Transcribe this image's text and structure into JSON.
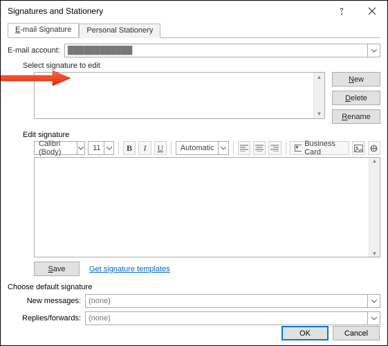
{
  "window": {
    "title": "Signatures and Stationery"
  },
  "tabs": {
    "email": "E-mail Signature",
    "personal": "Personal Stationery"
  },
  "labels": {
    "email_account": "E-mail account:",
    "select_sig": "Select signature to edit",
    "edit_sig": "Edit signature",
    "choose_default": "Choose default signature",
    "new_msg": "New messages:",
    "replies": "Replies/forwards:"
  },
  "account": {
    "value": "████████████"
  },
  "side": {
    "new": "New",
    "delete": "Delete",
    "rename": "Rename"
  },
  "toolbar": {
    "font": "Calibri (Body)",
    "size": "11",
    "auto": "Automatic",
    "business_card": "Business Card"
  },
  "save": {
    "label": "Save",
    "link": "Get signature templates"
  },
  "defaults": {
    "new_val": "(none)",
    "replies_val": "(none)"
  },
  "bottom": {
    "ok": "OK",
    "cancel": "Cancel"
  }
}
